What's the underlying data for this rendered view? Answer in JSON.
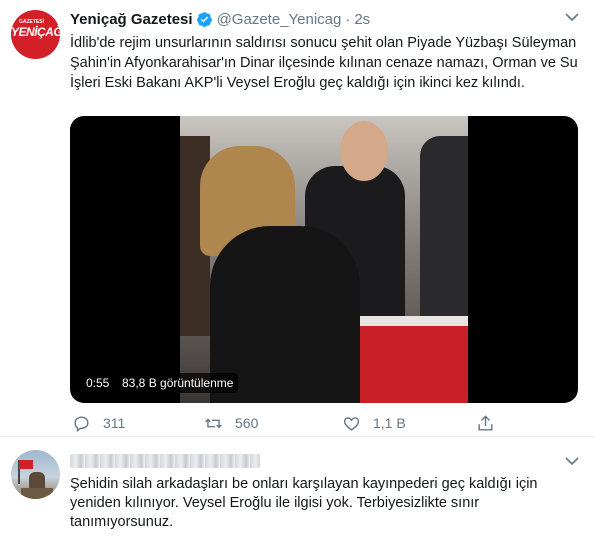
{
  "tweet": {
    "author_name": "Yeniçağ Gazetesi",
    "avatar_text": "YENİÇAĞ",
    "avatar_small_text": "GAZETESİ",
    "handle": "@Gazete_Yenicag",
    "separator": "·",
    "time": "2s",
    "text": "İdlib'de rejim unsurlarının saldırısı sonucu şehit olan Piyade Yüzbaşı Süleyman Şahin'in Afyonkarahisar'ın Dinar ilçesinde kılınan cenaze namazı, Orman ve Su İşleri Eski Bakanı AKP'li Veysel Eroğlu geç kaldığı için ikinci kez kılındı.",
    "video": {
      "duration": "0:55",
      "views": "83,8 B görüntülenme"
    },
    "actions": {
      "replies": "311",
      "retweets": "560",
      "likes": "1,1 B"
    },
    "colors": {
      "brand_red": "#d32027",
      "verified_blue": "#1da1f2",
      "muted_gray": "#657786"
    }
  },
  "reply": {
    "text": "Şehidin silah arkadaşları be onları karşılayan kayınpederi geç kaldığı için yeniden kılınıyor. Veysel Eroğlu ile ilgisi yok. Terbiyesizlikte sınır tanımıyorsunuz."
  }
}
